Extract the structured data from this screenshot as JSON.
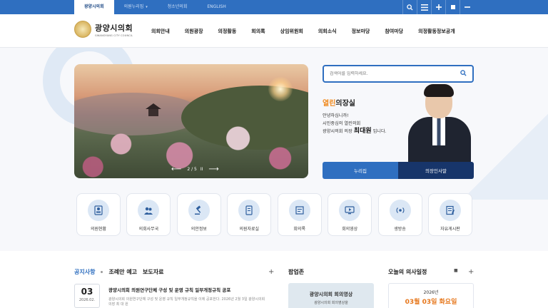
{
  "topbar": {
    "tabs": [
      {
        "label": "광양시의회",
        "active": true
      },
      {
        "label": "의원누리집",
        "caret": "▾"
      },
      {
        "label": "청소년의회"
      },
      {
        "label": "ENGLISH"
      }
    ],
    "icons": [
      "search-icon",
      "menu-icon",
      "zoom-in-icon",
      "stop-icon",
      "zoom-out-icon"
    ]
  },
  "header": {
    "logo_title": "광양시의회",
    "logo_sub": "GWANGYANG CITY COUNCIL",
    "nav": [
      "의회안내",
      "의원광장",
      "의정활동",
      "회의록",
      "상임위원회",
      "의회소식",
      "정보마당",
      "참여마당",
      "의정활동정보공개"
    ]
  },
  "slider": {
    "counter": "2 / 5",
    "prev": "⟵",
    "next": "⟶",
    "pause": "II"
  },
  "search": {
    "placeholder": "검색어를 입력하세요."
  },
  "chair": {
    "title_accent": "열린",
    "title_rest": "의장실",
    "line1": "안녕하십니까!",
    "line2": "시민중심의 열린의회",
    "line3_prefix": "광양시의회 의장",
    "name": "최대원",
    "line3_suffix": "입니다.",
    "btn_left": "누리집",
    "btn_right": "의장인사말"
  },
  "quick_menu": [
    {
      "label": "의원현황",
      "icon": "member-icon"
    },
    {
      "label": "의회사무국",
      "icon": "office-icon"
    },
    {
      "label": "의안정보",
      "icon": "gavel-icon"
    },
    {
      "label": "의원자료실",
      "icon": "document-icon"
    },
    {
      "label": "회의록",
      "icon": "minutes-icon"
    },
    {
      "label": "회의영상",
      "icon": "video-icon"
    },
    {
      "label": "생방송",
      "icon": "live-icon"
    },
    {
      "label": "자유게시판",
      "icon": "board-icon"
    }
  ],
  "notice": {
    "tabs": [
      "공지사항",
      "조례안 예고",
      "보도자료"
    ],
    "more": "+",
    "item": {
      "day": "03",
      "ym": "2026.02.",
      "title": "광양시의회 의원연구단체 구성 및 운영 규칙 일부개정규칙 공포",
      "summary": "광양시의회 의원연구단체 구성 및 운영 규칙 일부개정규칙을 이에 공포한다. 2026년 2월 3일 광양시의회의장 최 대 원"
    }
  },
  "popup": {
    "title": "팝업존",
    "line1": "광양시의회 회의영상",
    "line2": "광양시의회 회의영상을"
  },
  "schedule": {
    "title": "오늘의 의사일정",
    "pause": "■",
    "more": "+",
    "year": "2026년",
    "date": "03월 03일 화요일"
  }
}
